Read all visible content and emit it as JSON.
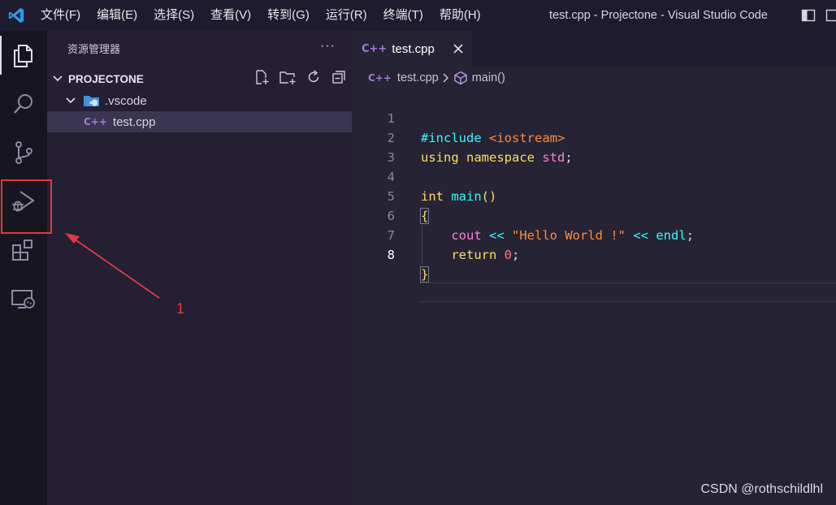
{
  "titlebar": {
    "menu": [
      "文件(F)",
      "编辑(E)",
      "选择(S)",
      "查看(V)",
      "转到(G)",
      "运行(R)",
      "终端(T)",
      "帮助(H)"
    ],
    "window_title": "test.cpp - Projectone - Visual Studio Code"
  },
  "activity_bar": {
    "items": [
      "explorer-icon",
      "search-icon",
      "source-control-icon",
      "run-debug-icon",
      "extensions-icon",
      "remote-explorer-icon"
    ],
    "active": "explorer-icon"
  },
  "sidebar": {
    "header": "资源管理器",
    "more": "···",
    "project": "PROJECTONE",
    "tree": [
      {
        "label": ".vscode",
        "kind": "folder"
      },
      {
        "label": "test.cpp",
        "kind": "file",
        "icon_text": "C++"
      }
    ]
  },
  "editor": {
    "tab": {
      "icon_text": "C++",
      "label": "test.cpp"
    },
    "breadcrumb": {
      "file": "test.cpp",
      "symbol": "main()"
    },
    "line_numbers": [
      "1",
      "2",
      "3",
      "4",
      "5",
      "6",
      "7",
      "8"
    ],
    "current_line": 8
  },
  "annotation": {
    "number": "1",
    "color": "#e4393c"
  },
  "watermark": "CSDN @rothschildlhl",
  "colors": {
    "keyword": "#fede5d",
    "string": "#ff8b39",
    "function": "#36f9f6",
    "operator": "#ff7edb",
    "number": "#f97e72",
    "background": "#262335"
  }
}
